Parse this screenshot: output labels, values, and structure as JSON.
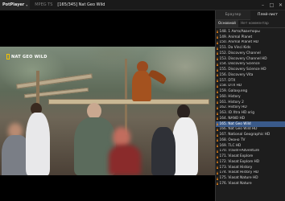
{
  "app": {
    "name": "PotPlayer",
    "file_format": "MPEG TS",
    "title": "[165/345] Nat Geo Wild"
  },
  "panel": {
    "tabs": [
      {
        "label": "Браузер",
        "active": false
      },
      {
        "label": "Плей-лист",
        "active": true
      }
    ],
    "subtabs": [
      {
        "label": "Основной",
        "active": true
      },
      {
        "label": "Нет комментар",
        "active": false
      }
    ],
    "playlist": [
      {
        "label": "148. 1 Авто/Авантюры",
        "active": false
      },
      {
        "label": "149. Animal Planet",
        "active": false
      },
      {
        "label": "150. Animal Planet HD",
        "active": false
      },
      {
        "label": "151. Da Vinci Kids",
        "active": false
      },
      {
        "label": "152. Discovery Channel",
        "active": false
      },
      {
        "label": "153. Discovery Channel HD",
        "active": false
      },
      {
        "label": "154. Discovery Science",
        "active": false
      },
      {
        "label": "155. Discovery Science HD",
        "active": false
      },
      {
        "label": "156. Discovery Vita",
        "active": false
      },
      {
        "label": "157. DTX",
        "active": false
      },
      {
        "label": "158. DTX HD",
        "active": false
      },
      {
        "label": "159. Galaxy.eng",
        "active": false
      },
      {
        "label": "160. History",
        "active": false
      },
      {
        "label": "161. History 2",
        "active": false
      },
      {
        "label": "162. History HD",
        "active": false
      },
      {
        "label": "163. ID Xtra HD orig",
        "active": false
      },
      {
        "label": "164. NANO HD",
        "active": false
      },
      {
        "label": "165. Nat Geo Wild",
        "active": true
      },
      {
        "label": "166. Nat Geo Wild HD",
        "active": false
      },
      {
        "label": "167. National Geographic HD",
        "active": false
      },
      {
        "label": "168. Оконо TV",
        "active": false
      },
      {
        "label": "169. TLC HD",
        "active": false
      },
      {
        "label": "170. Travel+Adventure",
        "active": false
      },
      {
        "label": "171. Viasat Explore",
        "active": false
      },
      {
        "label": "172. Viasat Explore HD",
        "active": false
      },
      {
        "label": "173. Viasat History",
        "active": false
      },
      {
        "label": "174. Viasat History HD",
        "active": false
      },
      {
        "label": "175. Viasat Nature HD",
        "active": false
      },
      {
        "label": "176. Viasat Nature",
        "active": false
      }
    ]
  },
  "video": {
    "logo_text": "NAT GEO WILD"
  },
  "colors": {
    "accent": "#3a5a8a",
    "cone": "#e8841c",
    "panel_bg": "#1d1d1d"
  }
}
